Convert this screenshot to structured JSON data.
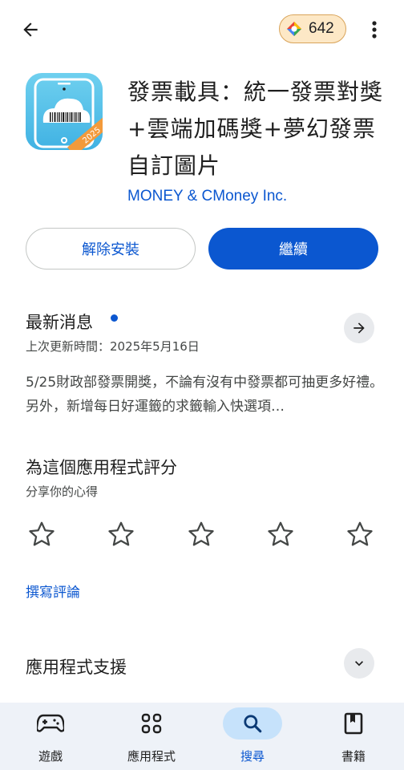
{
  "top_bar": {
    "points": "642"
  },
  "app": {
    "title": "發票載具：統一發票對獎+雲端加碼獎+夢幻發票自訂圖片",
    "developer": "MONEY & CMoney Inc.",
    "icon_year": "2025"
  },
  "actions": {
    "uninstall": "解除安裝",
    "continue": "繼續"
  },
  "whats_new": {
    "title": "最新消息",
    "updated": "上次更新時間：2025年5月16日",
    "notes": "5/25財政部發票開獎，不論有沒有中發票都可抽更多好禮。另外，新增每日好運籤的求籤輸入快選項…"
  },
  "rate": {
    "title": "為這個應用程式評分",
    "subtitle": "分享你的心得",
    "stars": 5,
    "write_review": "撰寫評論"
  },
  "support": {
    "title": "應用程式支援"
  },
  "bottom_nav": [
    {
      "label": "遊戲",
      "icon": "gamepad-icon"
    },
    {
      "label": "應用程式",
      "icon": "apps-grid-icon"
    },
    {
      "label": "搜尋",
      "icon": "search-icon",
      "active": true
    },
    {
      "label": "書籍",
      "icon": "book-icon"
    }
  ],
  "colors": {
    "accent": "#0b57d0",
    "chip_bg": "#fde8c6",
    "nav_bg": "#eef2f8",
    "nav_active": "#c6e2fb"
  }
}
